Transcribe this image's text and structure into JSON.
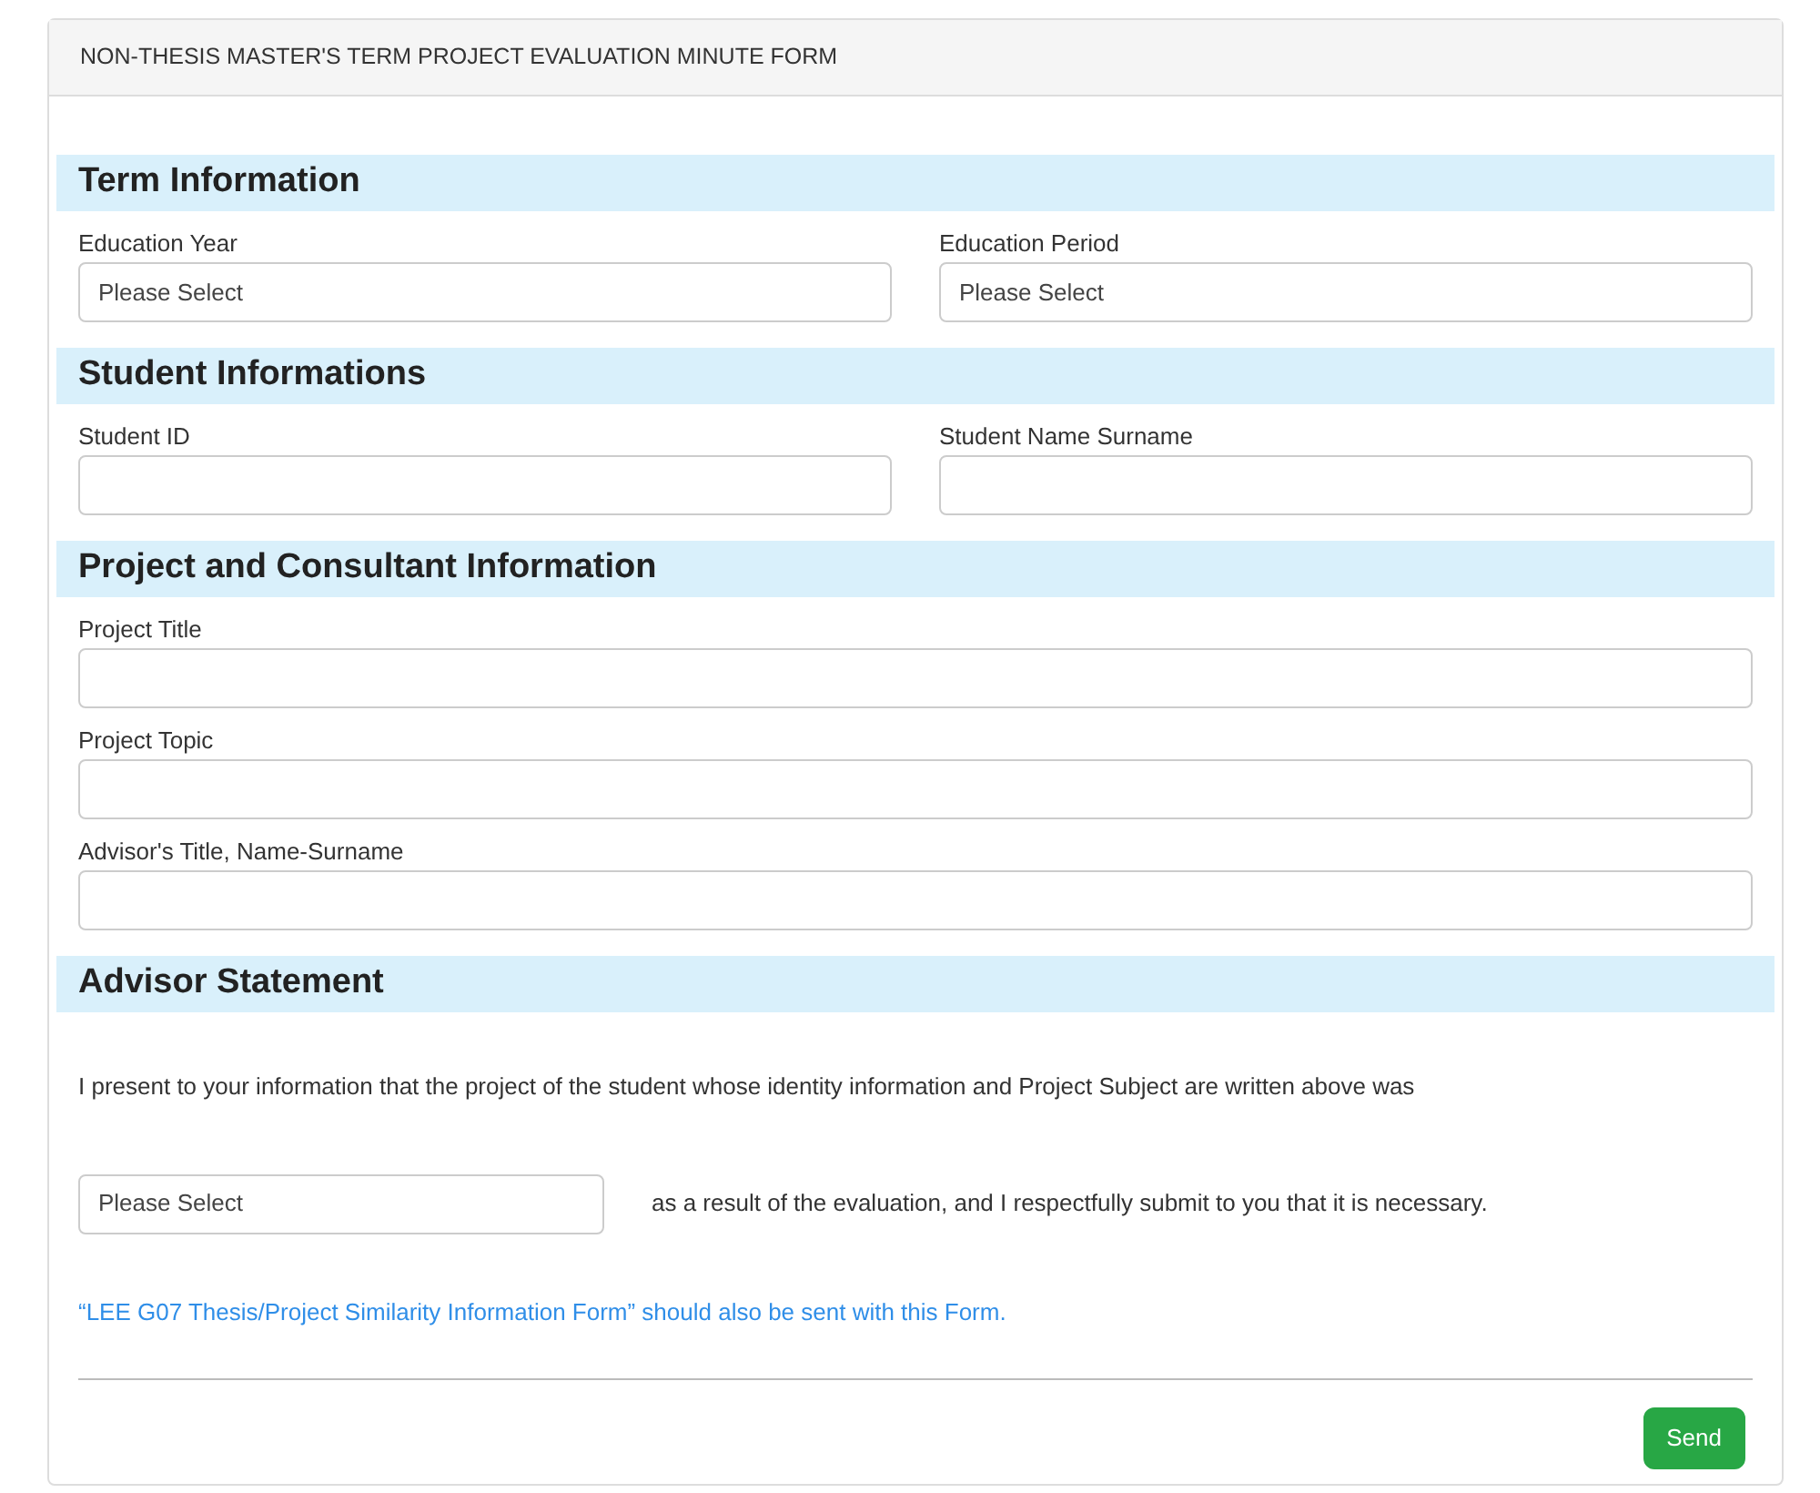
{
  "form_title": "NON-THESIS MASTER'S TERM PROJECT EVALUATION MINUTE FORM",
  "sections": [
    {
      "heading": "Term Information",
      "rows": [
        [
          {
            "label": "Education Year",
            "value": "Please Select"
          },
          {
            "label": "Education Period",
            "value": "Please Select"
          }
        ]
      ]
    },
    {
      "heading": "Student Informations",
      "rows": [
        [
          {
            "label": "Student ID"
          },
          {
            "label": "Student Name Surname"
          }
        ]
      ]
    },
    {
      "heading": "Project and Consultant Information",
      "rows": [
        [
          {
            "label": "Project Title"
          }
        ],
        [
          {
            "label": "Project Topic"
          }
        ],
        [
          {
            "label": "Advisor's Title, Name-Surname"
          }
        ]
      ]
    },
    {
      "heading": "Advisor Statement"
    }
  ],
  "statement": {
    "text": "I present to your information that the project of the student whose identity information and Project Subject are written above was",
    "select": {
      "value": "Please Select"
    },
    "continuation": "as a result of the evaluation, and I respectfully submit to you that it is necessary.",
    "note": "“LEE G07 Thesis/Project Similarity Information Form” should also be sent with this Form."
  },
  "submit_button": "Send"
}
